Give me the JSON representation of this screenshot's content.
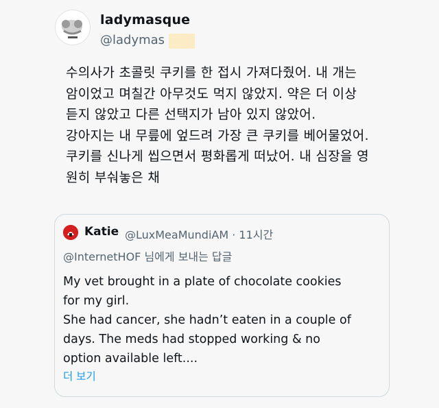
{
  "author": {
    "display_name": "ladymasque",
    "handle": "@ladymas"
  },
  "tweet": {
    "text": "수의사가 초콜릿 쿠키를 한 접시 가져다줬어. 내 개는\n암이었고 며칠간 아무것도 먹지 않았지. 약은 더 이상\n듣지 않았고 다른 선택지가 남아 있지 않았어.\n강아지는 내 무릎에 엎드려 가장 큰 쿠키를 베어물었어.\n쿠키를 신나게 씹으면서 평화롭게 떠났어. 내 심장을 영\n원히 부숴놓은 채"
  },
  "quote": {
    "author_name": "Katie",
    "handle_time": "@LuxMeaMundiAM · 11시간",
    "reply_to": "@InternetHOF 님에게 보내는 답글",
    "text": "My vet brought in a plate of chocolate cookies\nfor my girl.\nShe had cancer, she hadn’t eaten in a couple of\ndays. The meds had stopped working & no\noption available left....",
    "more_label": "더 보기"
  },
  "colors": {
    "link": "#1d9bf0",
    "secondary_text": "#536471",
    "border": "#cfd9de",
    "quote_avatar": "#d31f1f",
    "redaction": "#fbecc6"
  }
}
